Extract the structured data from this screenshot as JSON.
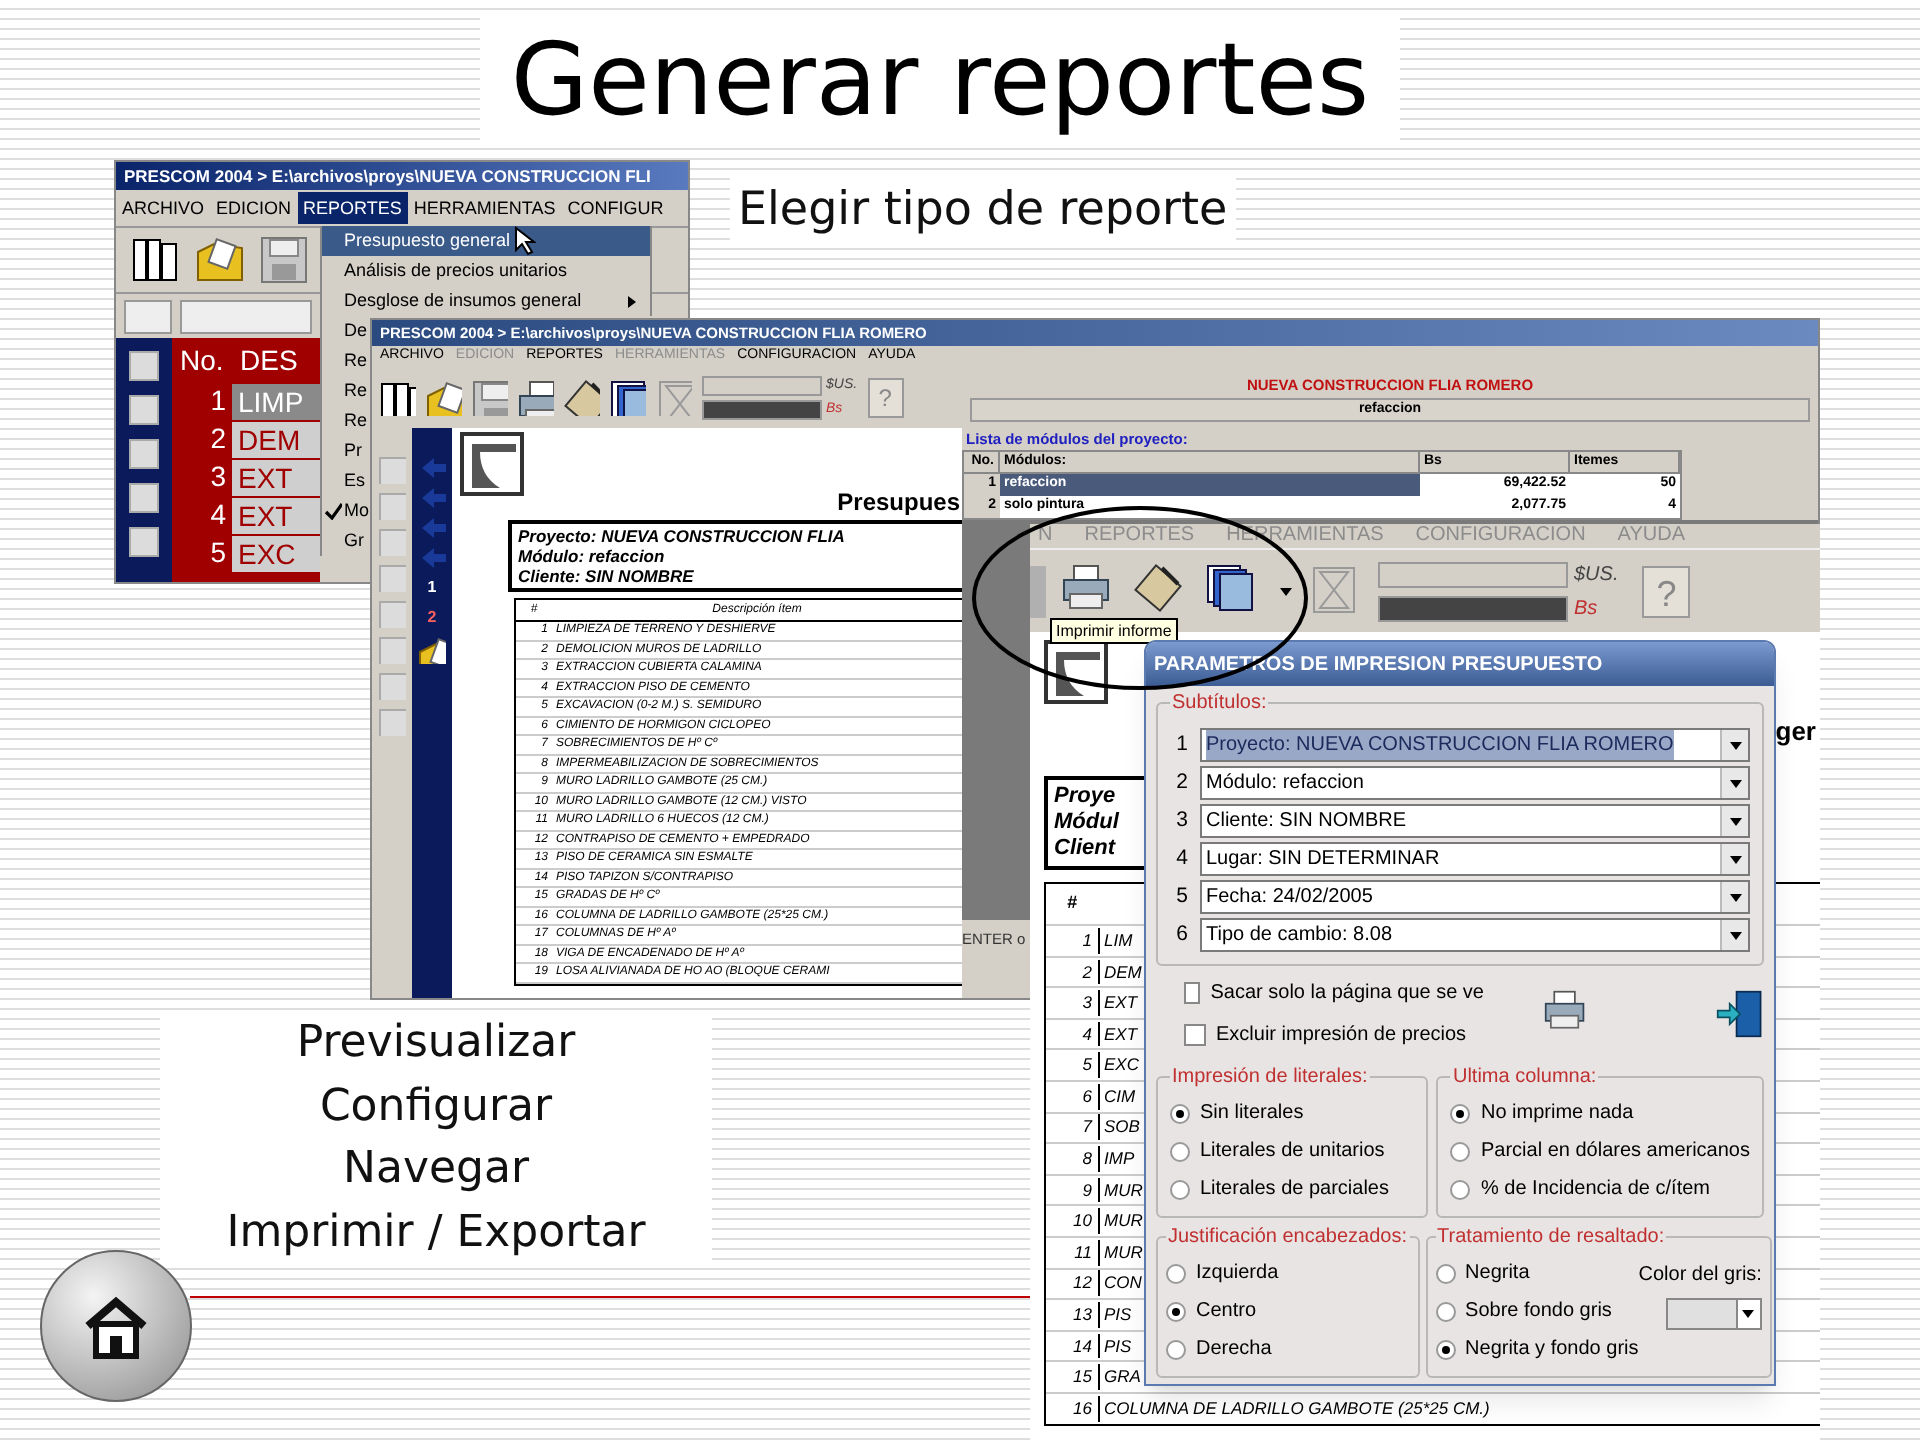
{
  "title": "Generar reportes",
  "subtitle": "Elegir tipo de reporte",
  "steps": [
    "Previsualizar",
    "Configurar",
    "Navegar",
    "Imprimir / Exportar"
  ],
  "menu_window": {
    "title": "PRESCOM 2004 > E:\\archivos\\proys\\NUEVA CONSTRUCCION FLI",
    "menu": [
      {
        "label": "ARCHIVO",
        "selected": false
      },
      {
        "label": "EDICION",
        "selected": false
      },
      {
        "label": "REPORTES",
        "selected": true
      },
      {
        "label": "HERRAMIENTAS",
        "selected": false
      },
      {
        "label": "CONFIGUR",
        "selected": false
      }
    ],
    "dropdown": [
      {
        "label": "Presupuesto general",
        "selected": true,
        "submenu": false,
        "checked": false
      },
      {
        "label": "Análisis de precios unitarios",
        "selected": false,
        "submenu": false,
        "checked": false
      },
      {
        "label": "Desglose de insumos general",
        "selected": false,
        "submenu": true,
        "checked": false
      },
      {
        "label": "De",
        "selected": false,
        "checked": false
      },
      {
        "label": "Re",
        "selected": false,
        "checked": false
      },
      {
        "label": "Re",
        "selected": false,
        "checked": false
      },
      {
        "label": "Re",
        "selected": false,
        "checked": false
      },
      {
        "label": "Pr",
        "selected": false,
        "checked": false
      },
      {
        "label": "Es",
        "selected": false,
        "checked": false
      },
      {
        "label": "Mo",
        "selected": false,
        "checked": true
      },
      {
        "label": "Gr",
        "selected": false,
        "checked": false
      }
    ],
    "table": {
      "columns": [
        "No.",
        "DES"
      ],
      "rows": [
        {
          "no": "1",
          "text": "LIMP",
          "selected": true
        },
        {
          "no": "2",
          "text": "DEM",
          "selected": false
        },
        {
          "no": "3",
          "text": "EXT",
          "selected": false
        },
        {
          "no": "4",
          "text": "EXT",
          "selected": false
        },
        {
          "no": "5",
          "text": "EXC",
          "selected": false
        }
      ]
    }
  },
  "preview_window": {
    "title": "PRESCOM 2004 > E:\\archivos\\proys\\NUEVA CONSTRUCCION FLIA ROMERO",
    "menu": [
      {
        "label": "ARCHIVO",
        "disabled": false
      },
      {
        "label": "EDICION",
        "disabled": true
      },
      {
        "label": "REPORTES",
        "disabled": false
      },
      {
        "label": "HERRAMIENTAS",
        "disabled": true
      },
      {
        "label": "CONFIGURACION",
        "disabled": false
      },
      {
        "label": "AYUDA",
        "disabled": false
      }
    ],
    "currency": [
      "$US.",
      "Bs"
    ],
    "help": "?",
    "project": "NUEVA CONSTRUCCION FLIA ROMERO",
    "module": "refaccion",
    "modules": {
      "title": "Lista de módulos del proyecto:",
      "columns": [
        "No.",
        "Módulos:",
        "Bs",
        "Itemes"
      ],
      "rows": [
        {
          "no": "1",
          "name": "refaccion",
          "bs": "69,422.52",
          "items": "50",
          "selected": true
        },
        {
          "no": "2",
          "name": "solo pintura",
          "bs": "2,077.75",
          "items": "4",
          "selected": false
        }
      ]
    },
    "status": "ENTER o",
    "pages": [
      {
        "label": "1",
        "selected": false
      },
      {
        "label": "2",
        "selected": true
      }
    ],
    "document": {
      "heading": "Presupues",
      "info": [
        "Proyecto: NUEVA CONSTRUCCION FLIA",
        "Módulo: refaccion",
        "Cliente: SIN NOMBRE"
      ],
      "columns": [
        "#",
        "Descripción ítem"
      ],
      "rows": [
        {
          "no": "1",
          "text": "LIMPIEZA DE TERRENO Y DESHIERVE"
        },
        {
          "no": "2",
          "text": "DEMOLICION MUROS DE LADRILLO"
        },
        {
          "no": "3",
          "text": "EXTRACCION CUBIERTA CALAMINA"
        },
        {
          "no": "4",
          "text": "EXTRACCION PISO DE CEMENTO"
        },
        {
          "no": "5",
          "text": "EXCAVACION (0-2 M.) S. SEMIDURO"
        },
        {
          "no": "6",
          "text": "CIMIENTO DE HORMIGON CICLOPEO"
        },
        {
          "no": "7",
          "text": "SOBRECIMIENTOS DE Hº Cº"
        },
        {
          "no": "8",
          "text": "IMPERMEABILIZACION DE SOBRECIMIENTOS"
        },
        {
          "no": "9",
          "text": "MURO LADRILLO GAMBOTE (25 CM.)"
        },
        {
          "no": "10",
          "text": "MURO LADRILLO GAMBOTE (12 CM.) VISTO"
        },
        {
          "no": "11",
          "text": "MURO LADRILLO 6 HUECOS (12 CM.)"
        },
        {
          "no": "12",
          "text": "CONTRAPISO DE CEMENTO + EMPEDRADO"
        },
        {
          "no": "13",
          "text": "PISO DE CERAMICA SIN ESMALTE"
        },
        {
          "no": "14",
          "text": "PISO TAPIZON S/CONTRAPISO"
        },
        {
          "no": "15",
          "text": "GRADAS DE Hº Cº"
        },
        {
          "no": "16",
          "text": "COLUMNA DE LADRILLO GAMBOTE (25*25 CM.)"
        },
        {
          "no": "17",
          "text": "COLUMNAS DE Hº Aº"
        },
        {
          "no": "18",
          "text": "VIGA DE ENCADENADO DE Hº Aº"
        },
        {
          "no": "19",
          "text": "LOSA ALIVIANADA DE HO AO (BLOQUE CERAMI"
        }
      ]
    }
  },
  "zoom_window": {
    "menu": [
      "N",
      "REPORTES",
      "HERRAMIENTAS",
      "CONFIGURACION",
      "AYUDA"
    ],
    "tooltip": "Imprimir informe",
    "currency": [
      "$US.",
      "Bs"
    ],
    "help": "?",
    "document": {
      "heading": "ger",
      "info": [
        "Proye",
        "Módul",
        "Client"
      ],
      "column": "#",
      "rows": [
        {
          "no": "1",
          "text": "LIM"
        },
        {
          "no": "2",
          "text": "DEM"
        },
        {
          "no": "3",
          "text": "EXT"
        },
        {
          "no": "4",
          "text": "EXT"
        },
        {
          "no": "5",
          "text": "EXC"
        },
        {
          "no": "6",
          "text": "CIM"
        },
        {
          "no": "7",
          "text": "SOB"
        },
        {
          "no": "8",
          "text": "IMP"
        },
        {
          "no": "9",
          "text": "MUR"
        },
        {
          "no": "10",
          "text": "MUR"
        },
        {
          "no": "11",
          "text": "MUR"
        },
        {
          "no": "12",
          "text": "CON"
        },
        {
          "no": "13",
          "text": "PIS"
        },
        {
          "no": "14",
          "text": "PIS"
        },
        {
          "no": "15",
          "text": "GRA"
        },
        {
          "no": "16",
          "text": "COLUMNA DE LADRILLO GAMBOTE (25*25 CM.)"
        }
      ]
    }
  },
  "dialog": {
    "title": "PARAMETROS DE IMPRESION PRESUPUESTO",
    "subtitles_label": "Subtítulos:",
    "subtitles": [
      {
        "num": "1",
        "value": "Proyecto: NUEVA CONSTRUCCION FLIA ROMERO",
        "selected": true
      },
      {
        "num": "2",
        "value": "Módulo: refaccion",
        "selected": false
      },
      {
        "num": "3",
        "value": "Cliente: SIN NOMBRE",
        "selected": false
      },
      {
        "num": "4",
        "value": "Lugar: SIN DETERMINAR",
        "selected": false
      },
      {
        "num": "5",
        "value": "Fecha: 24/02/2005",
        "selected": false
      },
      {
        "num": "6",
        "value": "Tipo de cambio: 8.08",
        "selected": false
      }
    ],
    "checkboxes": [
      {
        "label": "Sacar solo la página que se ve",
        "checked": false
      },
      {
        "label": "Excluir impresión de precios",
        "checked": false
      }
    ],
    "groups": [
      {
        "title": "Impresión de literales:",
        "options": [
          {
            "label": "Sin literales",
            "selected": true
          },
          {
            "label": "Literales de unitarios",
            "selected": false
          },
          {
            "label": "Literales de parciales",
            "selected": false
          }
        ]
      },
      {
        "title": "Ultima columna:",
        "options": [
          {
            "label": "No imprime nada",
            "selected": true
          },
          {
            "label": "Parcial en dólares americanos",
            "selected": false
          },
          {
            "label": "% de Incidencia de c/ítem",
            "selected": false
          }
        ]
      },
      {
        "title": "Justificación encabezados:",
        "options": [
          {
            "label": "Izquierda",
            "selected": false
          },
          {
            "label": "Centro",
            "selected": true
          },
          {
            "label": "Derecha",
            "selected": false
          }
        ]
      },
      {
        "title": "Tratamiento de resaltado:",
        "options": [
          {
            "label": "Negrita",
            "selected": false
          },
          {
            "label": "Sobre fondo gris",
            "selected": false
          },
          {
            "label": "Negrita y fondo gris",
            "selected": true
          }
        ]
      }
    ],
    "gray_color_label": "Color del gris:"
  }
}
